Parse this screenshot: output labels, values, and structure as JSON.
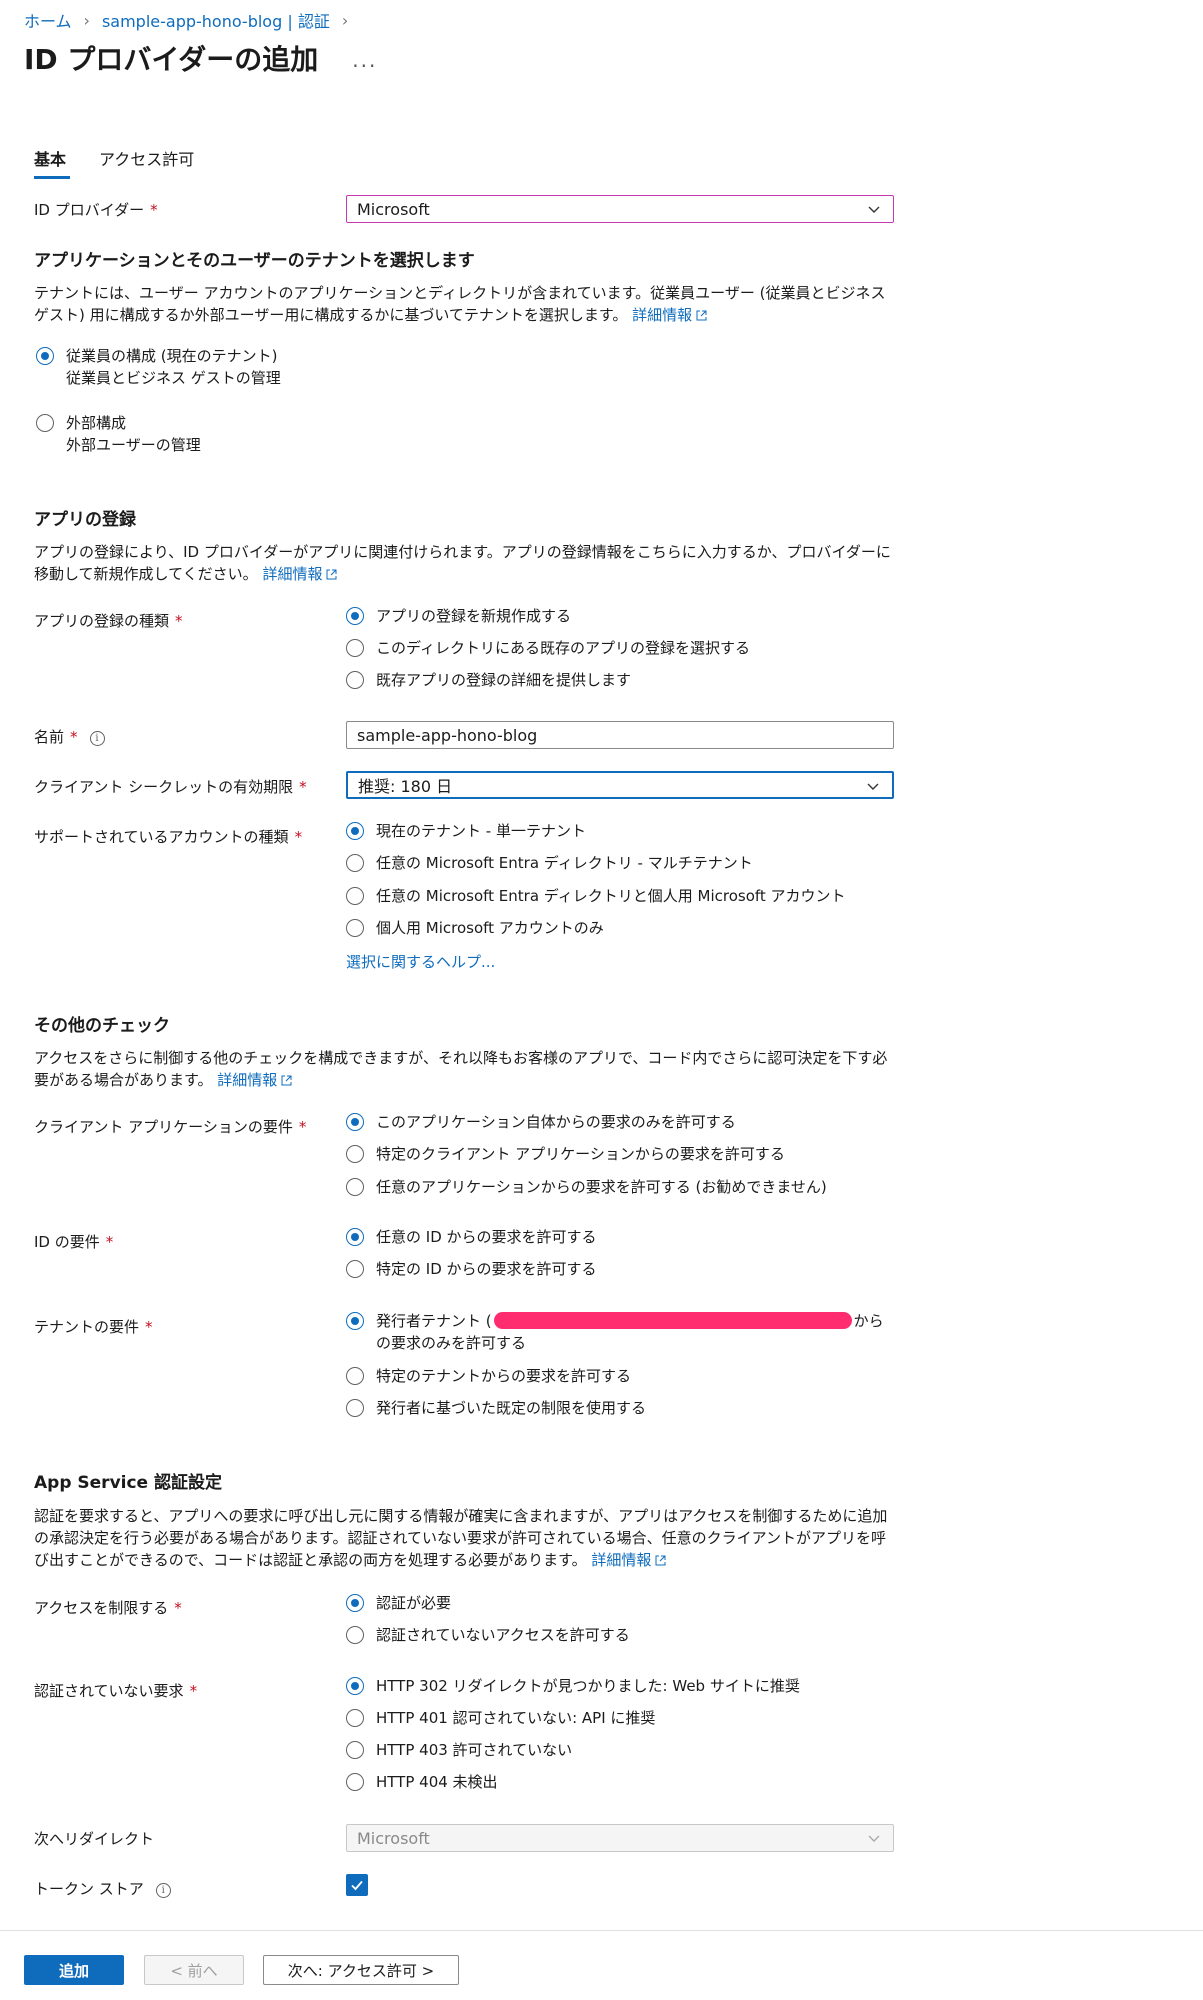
{
  "breadcrumb": {
    "home": "ホーム",
    "app": "sample-app-hono-blog | 認証"
  },
  "page_title": "ID プロバイダーの追加",
  "title_more": "...",
  "tabs": {
    "basic": "基本",
    "permissions": "アクセス許可"
  },
  "id_provider": {
    "label": "ID プロバイダー",
    "value": "Microsoft"
  },
  "tenant": {
    "title": "アプリケーションとそのユーザーのテナントを選択します",
    "desc": "テナントには、ユーザー アカウントのアプリケーションとディレクトリが含まれています。従業員ユーザー (従業員とビジネス ゲスト) 用に構成するか外部ユーザー用に構成するかに基づいてテナントを選択します。",
    "learn_more": "詳細情報",
    "opt1_title": "従業員の構成 (現在のテナント)",
    "opt1_sub": "従業員とビジネス ゲストの管理",
    "opt2_title": "外部構成",
    "opt2_sub": "外部ユーザーの管理"
  },
  "app_reg": {
    "title": "アプリの登録",
    "desc": "アプリの登録により、ID プロバイダーがアプリに関連付けられます。アプリの登録情報をこちらに入力するか、プロバイダーに移動して新規作成してください。",
    "learn_more": "詳細情報",
    "type_label": "アプリの登録の種類",
    "type_opt1": "アプリの登録を新規作成する",
    "type_opt2": "このディレクトリにある既存のアプリの登録を選択する",
    "type_opt3": "既存アプリの登録の詳細を提供します",
    "name_label": "名前",
    "name_value": "sample-app-hono-blog",
    "secret_label": "クライアント シークレットの有効期限",
    "secret_value": "推奨: 180 日",
    "account_label": "サポートされているアカウントの種類",
    "account_opt1": "現在のテナント - 単一テナント",
    "account_opt2": "任意の Microsoft Entra ディレクトリ - マルチテナント",
    "account_opt3": "任意の Microsoft Entra ディレクトリと個人用 Microsoft アカウント",
    "account_opt4": "個人用 Microsoft アカウントのみ",
    "help_link": "選択に関するヘルプ..."
  },
  "checks": {
    "title": "その他のチェック",
    "desc": "アクセスをさらに制御する他のチェックを構成できますが、それ以降もお客様のアプリで、コード内でさらに認可決定を下す必要がある場合があります。",
    "learn_more": "詳細情報",
    "client_label": "クライアント アプリケーションの要件",
    "client_opt1": "このアプリケーション自体からの要求のみを許可する",
    "client_opt2": "特定のクライアント アプリケーションからの要求を許可する",
    "client_opt3": "任意のアプリケーションからの要求を許可する (お勧めできません)",
    "id_label": "ID の要件",
    "id_opt1": "任意の ID からの要求を許可する",
    "id_opt2": "特定の ID からの要求を許可する",
    "tenant_label": "テナントの要件",
    "tenant_opt1_a": "発行者テナント (",
    "tenant_opt1_b": "から",
    "tenant_opt1_c": "の要求のみを許可する",
    "tenant_opt2": "特定のテナントからの要求を許可する",
    "tenant_opt3": "発行者に基づいた既定の制限を使用する"
  },
  "auth": {
    "title": "App Service 認証設定",
    "desc": "認証を要求すると、アプリへの要求に呼び出し元に関する情報が確実に含まれますが、アプリはアクセスを制御するために追加の承認決定を行う必要がある場合があります。認証されていない要求が許可されている場合、任意のクライアントがアプリを呼び出すことができるので、コードは認証と承認の両方を処理する必要があります。",
    "learn_more": "詳細情報",
    "restrict_label": "アクセスを制限する",
    "restrict_opt1": "認証が必要",
    "restrict_opt2": "認証されていないアクセスを許可する",
    "unauth_label": "認証されていない要求",
    "unauth_opt1": "HTTP 302 リダイレクトが見つかりました: Web サイトに推奨",
    "unauth_opt2": "HTTP 401 認可されていない: API に推奨",
    "unauth_opt3": "HTTP 403 許可されていない",
    "unauth_opt4": "HTTP 404 未検出",
    "redirect_label": "次へリダイレクト",
    "redirect_value": "Microsoft",
    "token_label": "トークン ストア"
  },
  "footer": {
    "add": "追加",
    "prev": "< 前へ",
    "next": "次へ: アクセス許可 >"
  },
  "colors": {
    "accent": "#0f6cbd",
    "required": "#c50f1f",
    "redaction": "#ff2d6f"
  }
}
